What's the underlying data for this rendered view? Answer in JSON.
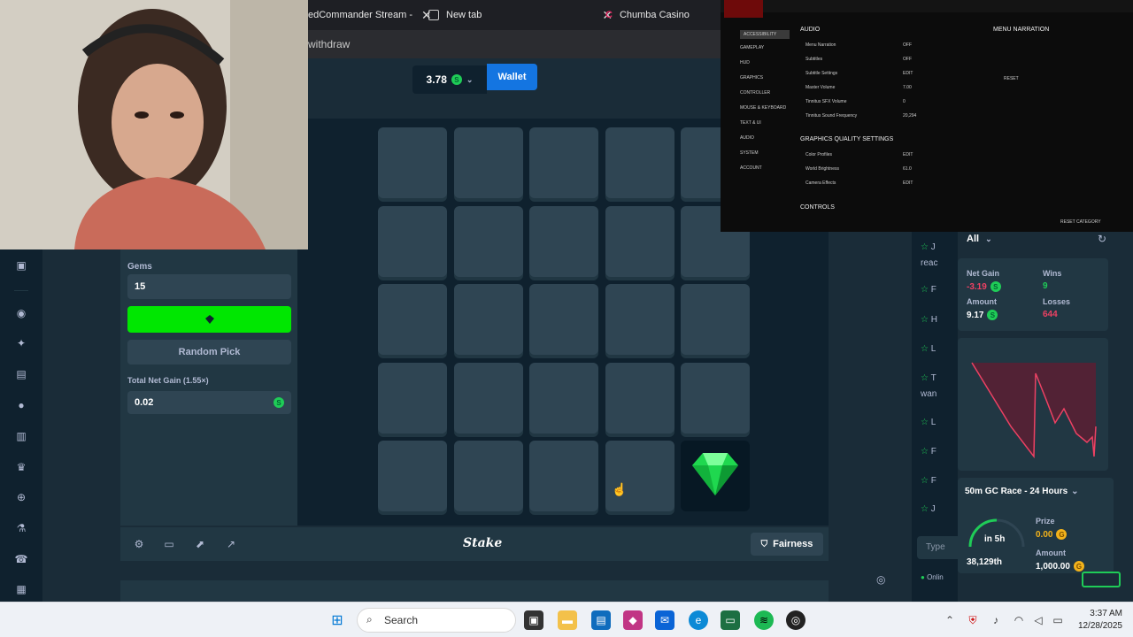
{
  "browser": {
    "tabs": [
      {
        "label": "edCommander Stream -",
        "closable": true
      },
      {
        "label": "New tab",
        "closable": true
      },
      {
        "label": "Chumba Casino",
        "closable": false
      }
    ],
    "address_text": "withdraw"
  },
  "header": {
    "balance": "3.78",
    "wallet_label": "Wallet"
  },
  "panel": {
    "gems_label": "Gems",
    "gems_value": "15",
    "random_pick_label": "Random Pick",
    "net_gain_label": "Total Net Gain (1.55×)",
    "net_gain_value": "0.02"
  },
  "board": {
    "rows": 5,
    "cols": 5,
    "revealed": [
      {
        "row": 4,
        "col": 4,
        "content": "gem-icon"
      }
    ]
  },
  "bottombar": {
    "logo": "Stake",
    "fairness_label": "Fairness"
  },
  "stats": {
    "filter": "All",
    "net_gain_label": "Net Gain",
    "net_gain_value": "-3.19",
    "wins_label": "Wins",
    "wins_value": "9",
    "amount_label": "Amount",
    "amount_value": "9.17",
    "losses_label": "Losses",
    "losses_value": "644",
    "race_title": "50m GC Race - 24 Hours",
    "race_timer": "in 5h",
    "race_rank": "38,129th",
    "prize_label": "Prize",
    "prize_value": "0.00",
    "race_amount_label": "Amount",
    "race_amount_value": "1,000.00"
  },
  "feed": {
    "items": [
      "J",
      "reac",
      "F",
      "H",
      "L",
      "T",
      "wan",
      "L",
      "F",
      "F",
      "J"
    ],
    "input_placeholder": "Type",
    "online_label": "Onlin"
  },
  "settings": {
    "nav": [
      "ACCESSIBILITY",
      "GAMEPLAY",
      "HUD",
      "GRAPHICS",
      "CONTROLLER",
      "MOUSE & KEYBOARD",
      "TEXT & UI",
      "AUDIO",
      "SYSTEM",
      "ACCOUNT"
    ],
    "section_audio": "AUDIO",
    "audio_rows": [
      "Menu Narration",
      "Subtitles",
      "Subtitle Settings",
      "Master Volume",
      "Tinnitus SFX Volume",
      "Tinnitus Sound Frequency"
    ],
    "audio_values": [
      "OFF",
      "OFF",
      "EDIT",
      "7.00",
      "0",
      "20,294"
    ],
    "section_graphics": "GRAPHICS QUALITY SETTINGS",
    "graphics_rows": [
      "Color Profiles",
      "World Brightness",
      "Camera Effects"
    ],
    "graphics_values": [
      "EDIT",
      "61.0",
      "EDIT"
    ],
    "section_controls": "CONTROLS",
    "side_title": "MENU NARRATION",
    "reset_label": "RESET",
    "reset_category": "RESET CATEGORY"
  },
  "taskbar": {
    "search_placeholder": "Search",
    "time": "3:37 AM",
    "date": "12/28/2025"
  },
  "colors": {
    "bg": "#1a2c38",
    "panel": "#213743",
    "tile": "#2f4553",
    "bet_green": "#00e701",
    "wallet_blue": "#1475e1",
    "loss_red": "#ed4163",
    "gem": "#1fd84f"
  }
}
